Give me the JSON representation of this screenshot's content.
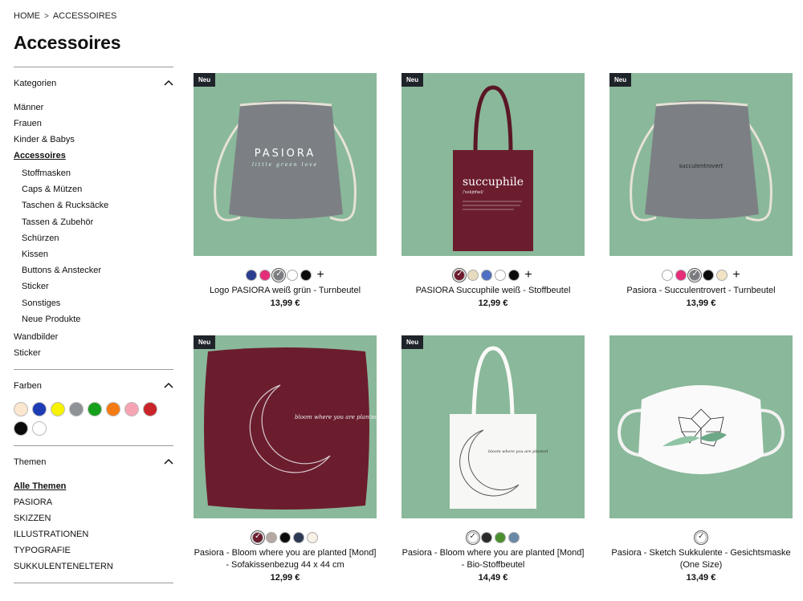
{
  "breadcrumb": {
    "home": "HOME",
    "separator": ">",
    "current": "ACCESSOIRES"
  },
  "page_title": "Accessoires",
  "sidebar": {
    "kategorien": {
      "title": "Kategorien",
      "items": [
        "Männer",
        "Frauen",
        "Kinder & Babys",
        "Accessoires"
      ],
      "active": "Accessoires",
      "sub_items": [
        "Stoffmasken",
        "Caps & Mützen",
        "Taschen & Rucksäcke",
        "Tassen & Zubehör",
        "Schürzen",
        "Kissen",
        "Buttons & Anstecker",
        "Sticker",
        "Sonstiges",
        "Neue Produkte"
      ],
      "items_after": [
        "Wandbilder",
        "Sticker"
      ]
    },
    "farben": {
      "title": "Farben",
      "colors": [
        "#fbe6d0",
        "#1c3bb5",
        "#f6f200",
        "#8f9296",
        "#14a01a",
        "#f57b14",
        "#f6a4b4",
        "#c8242a",
        "#0b0b0b",
        "#ffffff"
      ]
    },
    "themen": {
      "title": "Themen",
      "items": [
        "Alle Themen",
        "PASIORA",
        "SKIZZEN",
        "ILLUSTRATIONEN",
        "TYPOGRAFIE",
        "SUKKULENTENELTERN"
      ],
      "active": "Alle Themen"
    }
  },
  "products": [
    {
      "badge": "Neu",
      "name": "Logo PASIORA weiß grün - Turnbeutel",
      "price": "13,99 €",
      "colors": [
        "#2b3d8f",
        "#e52d7a",
        "#7a7c80",
        "#ffffff",
        "#0b0b0b"
      ],
      "selected": 2,
      "more": "+",
      "print_title": "PASIORA",
      "print_sub": "little green love",
      "product_type": "gym-bag",
      "bag_color": "#7c8085"
    },
    {
      "badge": "Neu",
      "name": "PASIORA Succuphile weiß - Stoffbeutel",
      "price": "12,99 €",
      "colors": [
        "#6e1a2c",
        "#e8dcc0",
        "#4f6fc2",
        "#ffffff",
        "#0b0b0b"
      ],
      "selected": 0,
      "more": "+",
      "print_title": "succuphile",
      "print_sub": "/ˈsʌkjʊfaɪl/",
      "product_type": "tote-bag",
      "bag_color": "#6b1d2e"
    },
    {
      "badge": "Neu",
      "name": "Pasiora - Succulentrovert - Turnbeutel",
      "price": "13,99 €",
      "colors": [
        "#ffffff",
        "#e52d7a",
        "#7a7c80",
        "#0b0b0b",
        "#f1e3c4"
      ],
      "selected": 2,
      "more": "+",
      "print_title": "succulentrovert",
      "product_type": "gym-bag",
      "bag_color": "#7c8085"
    },
    {
      "badge": "Neu",
      "name": "Pasiora - Bloom where you are planted [Mond] - Sofakissenbezug 44 x 44 cm",
      "price": "12,99 €",
      "colors": [
        "#6b1d2e",
        "#b6a8a2",
        "#0b0b0b",
        "#2d3a55",
        "#f7f1e6"
      ],
      "selected": 0,
      "print_title": "bloom where you are planted",
      "product_type": "cushion",
      "bag_color": "#6b1d2e"
    },
    {
      "badge": "Neu",
      "name": "Pasiora - Bloom where you are planted [Mond] - Bio-Stoffbeutel",
      "price": "14,49 €",
      "colors": [
        "#ffffff",
        "#2b2b2b",
        "#4b8f2f",
        "#6a88a8"
      ],
      "selected": 0,
      "print_title": "bloom where you are planted",
      "product_type": "tote-bag",
      "bag_color": "#f7f7f5"
    },
    {
      "badge": "",
      "name": "Pasiora - Sketch Sukkulente - Gesichtsmaske (One Size)",
      "price": "13,49 €",
      "colors": [
        "#ffffff"
      ],
      "selected": 0,
      "product_type": "face-mask",
      "bag_color": "#ffffff"
    }
  ]
}
